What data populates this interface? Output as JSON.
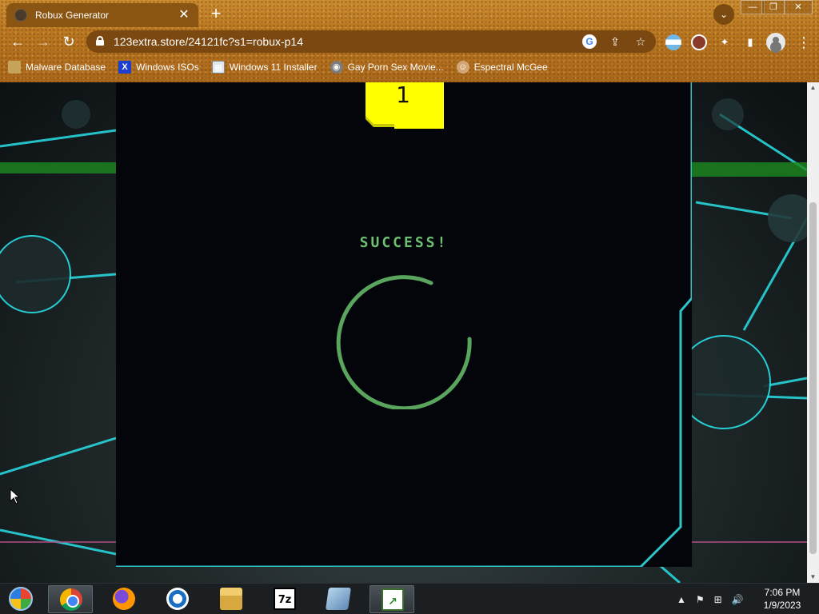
{
  "browser": {
    "tab_title": "Robux Generator",
    "tab_close": "✕",
    "new_tab": "+",
    "url": "123extra.store/24121fc?s1=robux-p14",
    "window_controls": {
      "minimize": "—",
      "maximize": "❐",
      "close": "✕"
    },
    "nav": {
      "back": "←",
      "forward": "→",
      "reload": "↻"
    },
    "omnibox_icons": {
      "google": "G",
      "share": "⇪",
      "star": "☆"
    },
    "extensions": {
      "puzzle": "✦",
      "sidepanel": "▮",
      "menu": "⋮",
      "tabsearch": "⌄"
    }
  },
  "bookmarks": [
    {
      "label": "Malware Database",
      "icon": "folder-icon",
      "glyph": ""
    },
    {
      "label": "Windows ISOs",
      "icon": "x-icon",
      "glyph": "X"
    },
    {
      "label": "Windows 11 Installer",
      "icon": "image-icon",
      "glyph": "▦"
    },
    {
      "label": "Gay Porn Sex Movie...",
      "icon": "disk-icon",
      "glyph": "◉"
    },
    {
      "label": "Espectral McGee",
      "icon": "face-icon",
      "glyph": "☺"
    }
  ],
  "page": {
    "step_number": "1",
    "status_text": "SUCCESS!",
    "accent_color": "#6fbf73",
    "badge_color": "#ffff00",
    "border_color": "#2ec4c8"
  },
  "taskbar": {
    "apps": [
      "Start",
      "Google Chrome",
      "Firefox",
      "Opera",
      "File Explorer",
      "7-Zip",
      "Notepad",
      "Chart app"
    ],
    "app_glyphs": {
      "7zip": "7z",
      "chart": "↗"
    },
    "tray_icons": {
      "expand": "▲",
      "flag": "⚑",
      "network": "⊞",
      "volume": "🔊"
    },
    "time": "7:06 PM",
    "date": "1/9/2023"
  }
}
